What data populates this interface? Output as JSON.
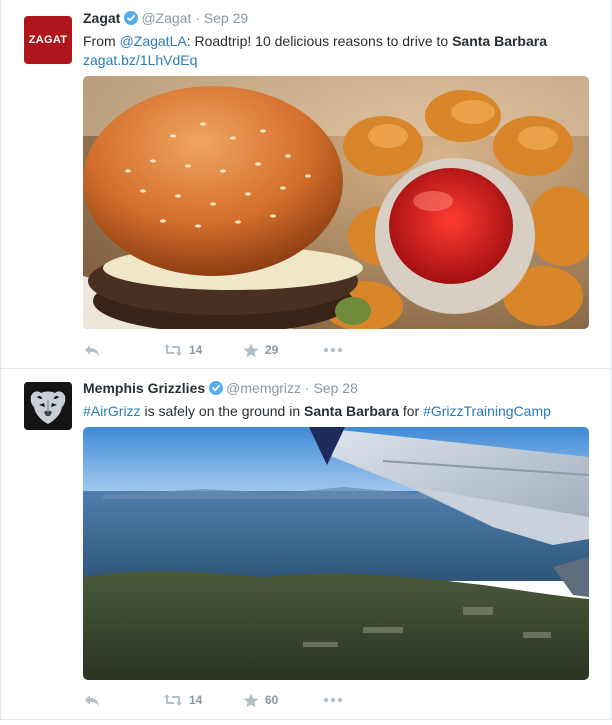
{
  "tweets": [
    {
      "account_name": "Zagat",
      "handle": "@Zagat",
      "separator": "·",
      "date": "Sep 29",
      "avatar_text": "ZAGAT",
      "text": {
        "prefix": "From ",
        "mention": "@ZagatLA",
        "body": ": Roadtrip! 10 delicious reasons to drive to ",
        "place": "Santa Barbara",
        "link": "zagat.bz/1LhVdEq"
      },
      "retweets": "14",
      "favorites": "29"
    },
    {
      "account_name": "Memphis Grizzlies",
      "handle": "@memgrizz",
      "separator": "·",
      "date": "Sep 28",
      "text": {
        "hashtag1": "#AirGrizz",
        "body1": " is safely on the ground in ",
        "place": "Santa Barbara",
        "body2": " for ",
        "hashtag2": "#GrizzTrainingCamp"
      },
      "retweets": "14",
      "favorites": "60"
    }
  ],
  "colors": {
    "accent": "#2b7bb9",
    "verified": "#55acee",
    "muted": "#8899a6",
    "zagat_red": "#b0141c"
  },
  "icons": [
    "verified-badge-icon",
    "reply-icon",
    "retweet-icon",
    "star-icon",
    "more-icon",
    "grizzlies-logo-icon"
  ]
}
